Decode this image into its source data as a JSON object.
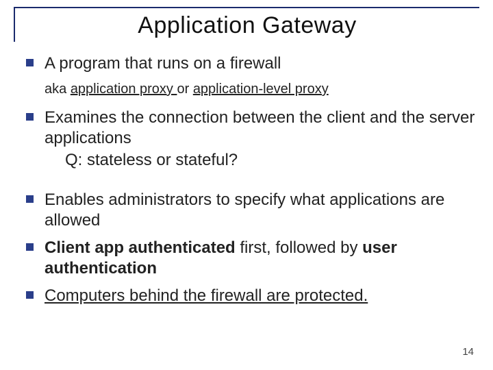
{
  "title": "Application Gateway",
  "bullet1": "A program that runs on a firewall",
  "bullet1_sub_pre": "aka ",
  "bullet1_sub_u1": "application proxy ",
  "bullet1_sub_mid": "or ",
  "bullet1_sub_u2": "application-level proxy",
  "bullet2": "Examines the connection between the client and the server applications",
  "bullet2_q": " Q: stateless or stateful?",
  "bullet3": "Enables administrators to specify what applications are allowed",
  "bullet4_b1": "Client app authenticated",
  "bullet4_mid": " first, followed by ",
  "bullet4_b2": "user authentication",
  "bullet5": "Computers behind the firewall are protected.",
  "page": "14"
}
